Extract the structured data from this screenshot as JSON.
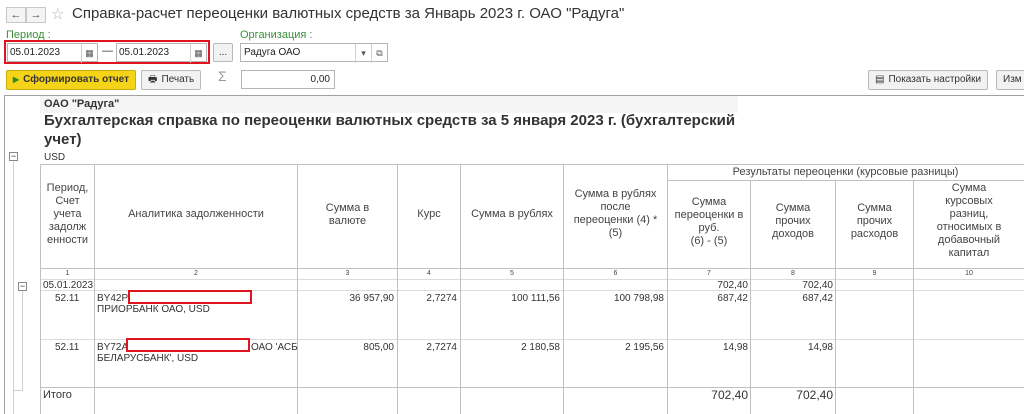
{
  "window": {
    "title": "Справка-расчет переоценки валютных средств за Январь 2023 г. ОАО \"Радуга\"",
    "nav_back": "←",
    "nav_forward": "→",
    "star": "☆"
  },
  "filters": {
    "period_label": "Период :",
    "date_from": "05.01.2023",
    "dash": "—",
    "date_to": "05.01.2023",
    "ellipsis": "...",
    "org_label": "Организация :",
    "org_value": "Радуга ОАО"
  },
  "toolbar": {
    "generate": "Сформировать отчет",
    "print": "Печать",
    "sigma": "Σ",
    "sum_value": "0,00",
    "show_settings": "Показать настройки",
    "change": "Изм"
  },
  "report": {
    "company": "ОАО \"Радуга\"",
    "title_line1": "Бухгалтерская справка по переоценки валютных средств за 5 января 2023 г. (бухгалтерский",
    "title_line2": "учет)",
    "currency": "USD",
    "group_header": "Результаты переоценки (курсовые разницы)",
    "columns": [
      {
        "no": "1",
        "header": [
          "Период,",
          "Счет",
          "учета",
          "задолж",
          "енности"
        ]
      },
      {
        "no": "2",
        "header": [
          "Аналитика задолженности"
        ]
      },
      {
        "no": "3",
        "header": [
          "Сумма в",
          "валюте"
        ]
      },
      {
        "no": "4",
        "header": [
          "Курс"
        ]
      },
      {
        "no": "5",
        "header": [
          "Сумма в рублях"
        ]
      },
      {
        "no": "6",
        "header": [
          "Сумма в рублях",
          "после",
          "переоценки (4) *",
          "(5)"
        ]
      },
      {
        "no": "7",
        "header": [
          "Сумма",
          "переоценки в",
          "руб.",
          "(6) - (5)"
        ]
      },
      {
        "no": "8",
        "header": [
          "Сумма",
          "прочих",
          "доходов"
        ]
      },
      {
        "no": "9",
        "header": [
          "Сумма",
          "прочих",
          "расходов"
        ]
      },
      {
        "no": "10",
        "header": [
          "Сумма",
          "курсовых",
          "разниц,",
          "относимых в",
          "добавочный",
          "капитал"
        ]
      }
    ],
    "date_row": {
      "period": "05.01.2023",
      "c7": "702,40",
      "c8": "702,40"
    },
    "rows": [
      {
        "account": "52.11",
        "analytics_line1": "BY42P",
        "analytics_line2": "ПРИОРБАНК ОАО, USD",
        "sum_currency": "36 957,90",
        "rate": "2,7274",
        "sum_rub": "100 111,56",
        "sum_after": "100 798,98",
        "reval": "687,42",
        "income": "687,42"
      },
      {
        "account": "52.11",
        "analytics_line1": "BY72A",
        "analytics_tail": "ОАО 'АСБ",
        "analytics_line2": "БЕЛАРУСБАНК', USD",
        "sum_currency": "805,00",
        "rate": "2,7274",
        "sum_rub": "2 180,58",
        "sum_after": "2 195,56",
        "reval": "14,98",
        "income": "14,98"
      }
    ],
    "total": {
      "label": "Итого",
      "reval": "702,40",
      "income": "702,40"
    }
  },
  "colors": {
    "accent": "#f5d417",
    "highlight": "#e0141e",
    "label_green": "#3a8f3a"
  }
}
